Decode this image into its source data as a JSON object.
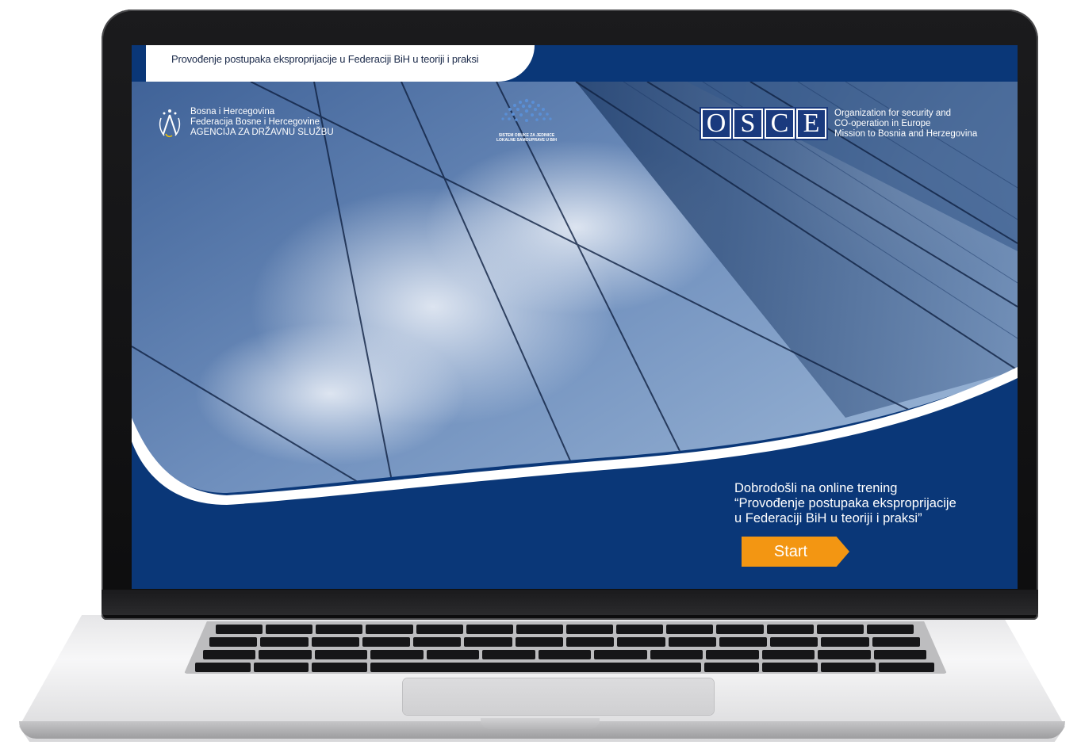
{
  "course": {
    "title": "Provođenje postupaka eksproprijacije u Federaciji BiH u teoriji i praksi"
  },
  "logos": {
    "agency": {
      "lines": [
        "Bosna i Hercegovina",
        "Federacija Bosne i Hercegovine",
        "AGENCIJA ZA DRŽAVNU SLUŽBU"
      ]
    },
    "sistem": {
      "lines": [
        "SISTEM OBUKE ZA JEDINICE",
        "LOKALNE SAMOUPRAVE U BIH"
      ]
    },
    "osce": {
      "letters": [
        "O",
        "S",
        "C",
        "E"
      ],
      "lines": [
        "Organization for security and",
        "CO-operation in Europe",
        "Mission to Bosnia and Herzegovina"
      ]
    }
  },
  "welcome": {
    "lines": [
      "Dobrodošli na online trening",
      "“Provođenje postupaka eksproprijacije",
      "u Federaciji BiH u teoriji i praksi”"
    ]
  },
  "start_button": {
    "label": "Start"
  },
  "colors": {
    "navy": "#0a3778",
    "accent_orange": "#f39612",
    "osce_blue": "#1a3a7e"
  }
}
